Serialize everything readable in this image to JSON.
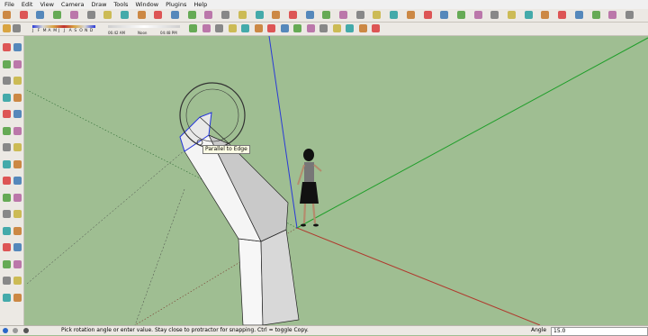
{
  "menu": [
    "File",
    "Edit",
    "View",
    "Camera",
    "Draw",
    "Tools",
    "Window",
    "Plugins",
    "Help"
  ],
  "shadow": {
    "months": [
      "J",
      "F",
      "M",
      "A",
      "M",
      "J",
      "J",
      "A",
      "S",
      "O",
      "N",
      "D"
    ],
    "time_start": "06:42 AM",
    "time_noon": "Noon",
    "time_end": "04:48 PM"
  },
  "viewport": {
    "tooltip": "Parallel to Edge"
  },
  "status": {
    "message": "Pick rotation angle or enter value.  Stay close to protractor for snapping.  Ctrl = toggle Copy.",
    "vcb_label": "Angle",
    "vcb_value": "15.0"
  },
  "colors": {
    "ground": "#9fbe92",
    "red_axis": "#b03a2e",
    "green_axis": "#1f9e2a",
    "blue_axis": "#2a3bd6",
    "selection": "#2233dd"
  },
  "icons": {
    "toolbar_row1": [
      "select-icon",
      "eraser-icon",
      "paint-icon",
      "line-icon",
      "arc-icon",
      "freehand-icon",
      "rectangle-icon",
      "circle-icon",
      "polygon-icon",
      "move-icon",
      "pushpull-icon",
      "rotate-icon",
      "followme-icon",
      "scale-icon",
      "offset-icon",
      "tape-icon",
      "dimension-icon",
      "protractor-icon",
      "text-icon",
      "axes-icon",
      "3dtext-icon",
      "orbit-icon",
      "pan-icon",
      "zoom-icon",
      "zoom-window-icon",
      "zoom-extents-icon",
      "previous-icon",
      "next-icon",
      "position-camera-icon",
      "walk-icon",
      "lookaround-icon",
      "section-icon",
      "xray-icon",
      "wireframe-icon",
      "hiddenline-icon",
      "shaded-icon",
      "textured-icon",
      "monochrome-icon"
    ],
    "toolbar_row2": [
      "iso-view-icon",
      "top-view-icon",
      "front-view-icon",
      "right-view-icon",
      "back-view-icon",
      "left-view-icon",
      "bottom-view-icon",
      "component-icon",
      "group-icon",
      "shadows-icon",
      "fog-icon",
      "style-icon",
      "layers-icon",
      "outliner-icon",
      "scenes-icon"
    ],
    "left_tools": [
      "select-icon",
      "component-icon",
      "paint-icon",
      "eraser-icon",
      "rectangle-icon",
      "line-icon",
      "circle-icon",
      "arc-icon",
      "polygon-icon",
      "freehand-icon",
      "move-icon",
      "pushpull-icon",
      "rotate-icon",
      "followme-icon",
      "scale-icon",
      "offset-icon",
      "tape-icon",
      "dimension-icon",
      "protractor-icon",
      "text-icon",
      "axes-icon",
      "3dtext-icon",
      "orbit-icon",
      "pan-icon",
      "zoom-icon",
      "zoom-window-icon",
      "zoom-extents-icon",
      "previous-icon",
      "position-camera-icon",
      "walk-icon",
      "lookaround-icon",
      "section-icon"
    ]
  }
}
